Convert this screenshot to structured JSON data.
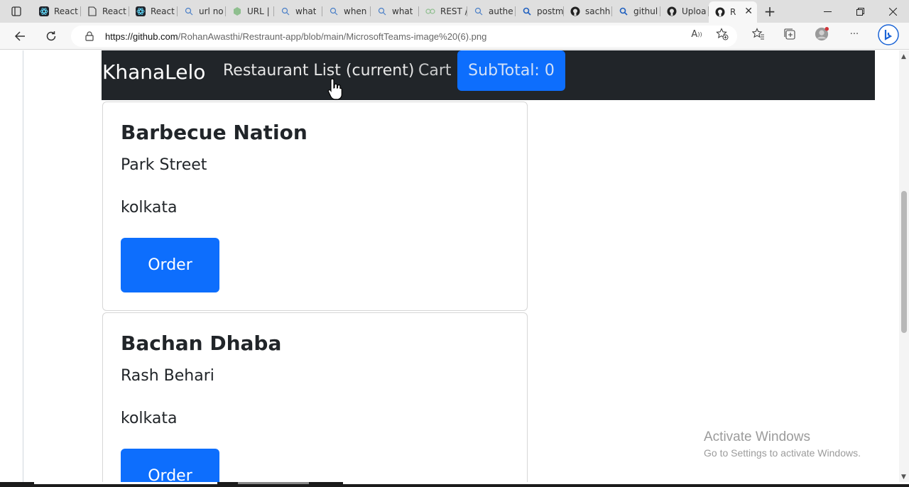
{
  "browser": {
    "tabs": [
      {
        "label": "React",
        "icon": "react-icon"
      },
      {
        "label": "React",
        "icon": "document-icon"
      },
      {
        "label": "React",
        "icon": "react-icon"
      },
      {
        "label": "url no",
        "icon": "search-icon"
      },
      {
        "label": "URL |",
        "icon": "site-icon"
      },
      {
        "label": "what",
        "icon": "search-icon"
      },
      {
        "label": "when",
        "icon": "search-icon"
      },
      {
        "label": "what",
        "icon": "search-icon"
      },
      {
        "label": "REST /",
        "icon": "site-icon"
      },
      {
        "label": "authe",
        "icon": "search-icon"
      },
      {
        "label": "postm",
        "icon": "search-icon"
      },
      {
        "label": "sachh",
        "icon": "github-icon"
      },
      {
        "label": "githul",
        "icon": "search-icon"
      },
      {
        "label": "Uploa",
        "icon": "github-icon"
      }
    ],
    "active_tab": {
      "label": "R",
      "icon": "github-icon"
    },
    "url_host": "https://github.com",
    "url_path": "/RohanAwasthi/Restraunt-app/blob/main/MicrosoftTeams-image%20(6).png"
  },
  "app": {
    "brand": "KhanaLelo",
    "nav_restaurant": "Restaurant List (current)",
    "nav_cart": "Cart",
    "subtotal": "SubTotal: 0"
  },
  "restaurants": [
    {
      "name": "Barbecue Nation",
      "address": "Park Street",
      "city": "kolkata",
      "button": "Order"
    },
    {
      "name": "Bachan Dhaba",
      "address": "Rash Behari",
      "city": "kolkata",
      "button": "Order"
    }
  ],
  "watermark": {
    "title": "Activate Windows",
    "subtitle": "Go to Settings to activate Windows."
  },
  "colors": {
    "navbar": "#212529",
    "primary": "#0d6efd"
  }
}
